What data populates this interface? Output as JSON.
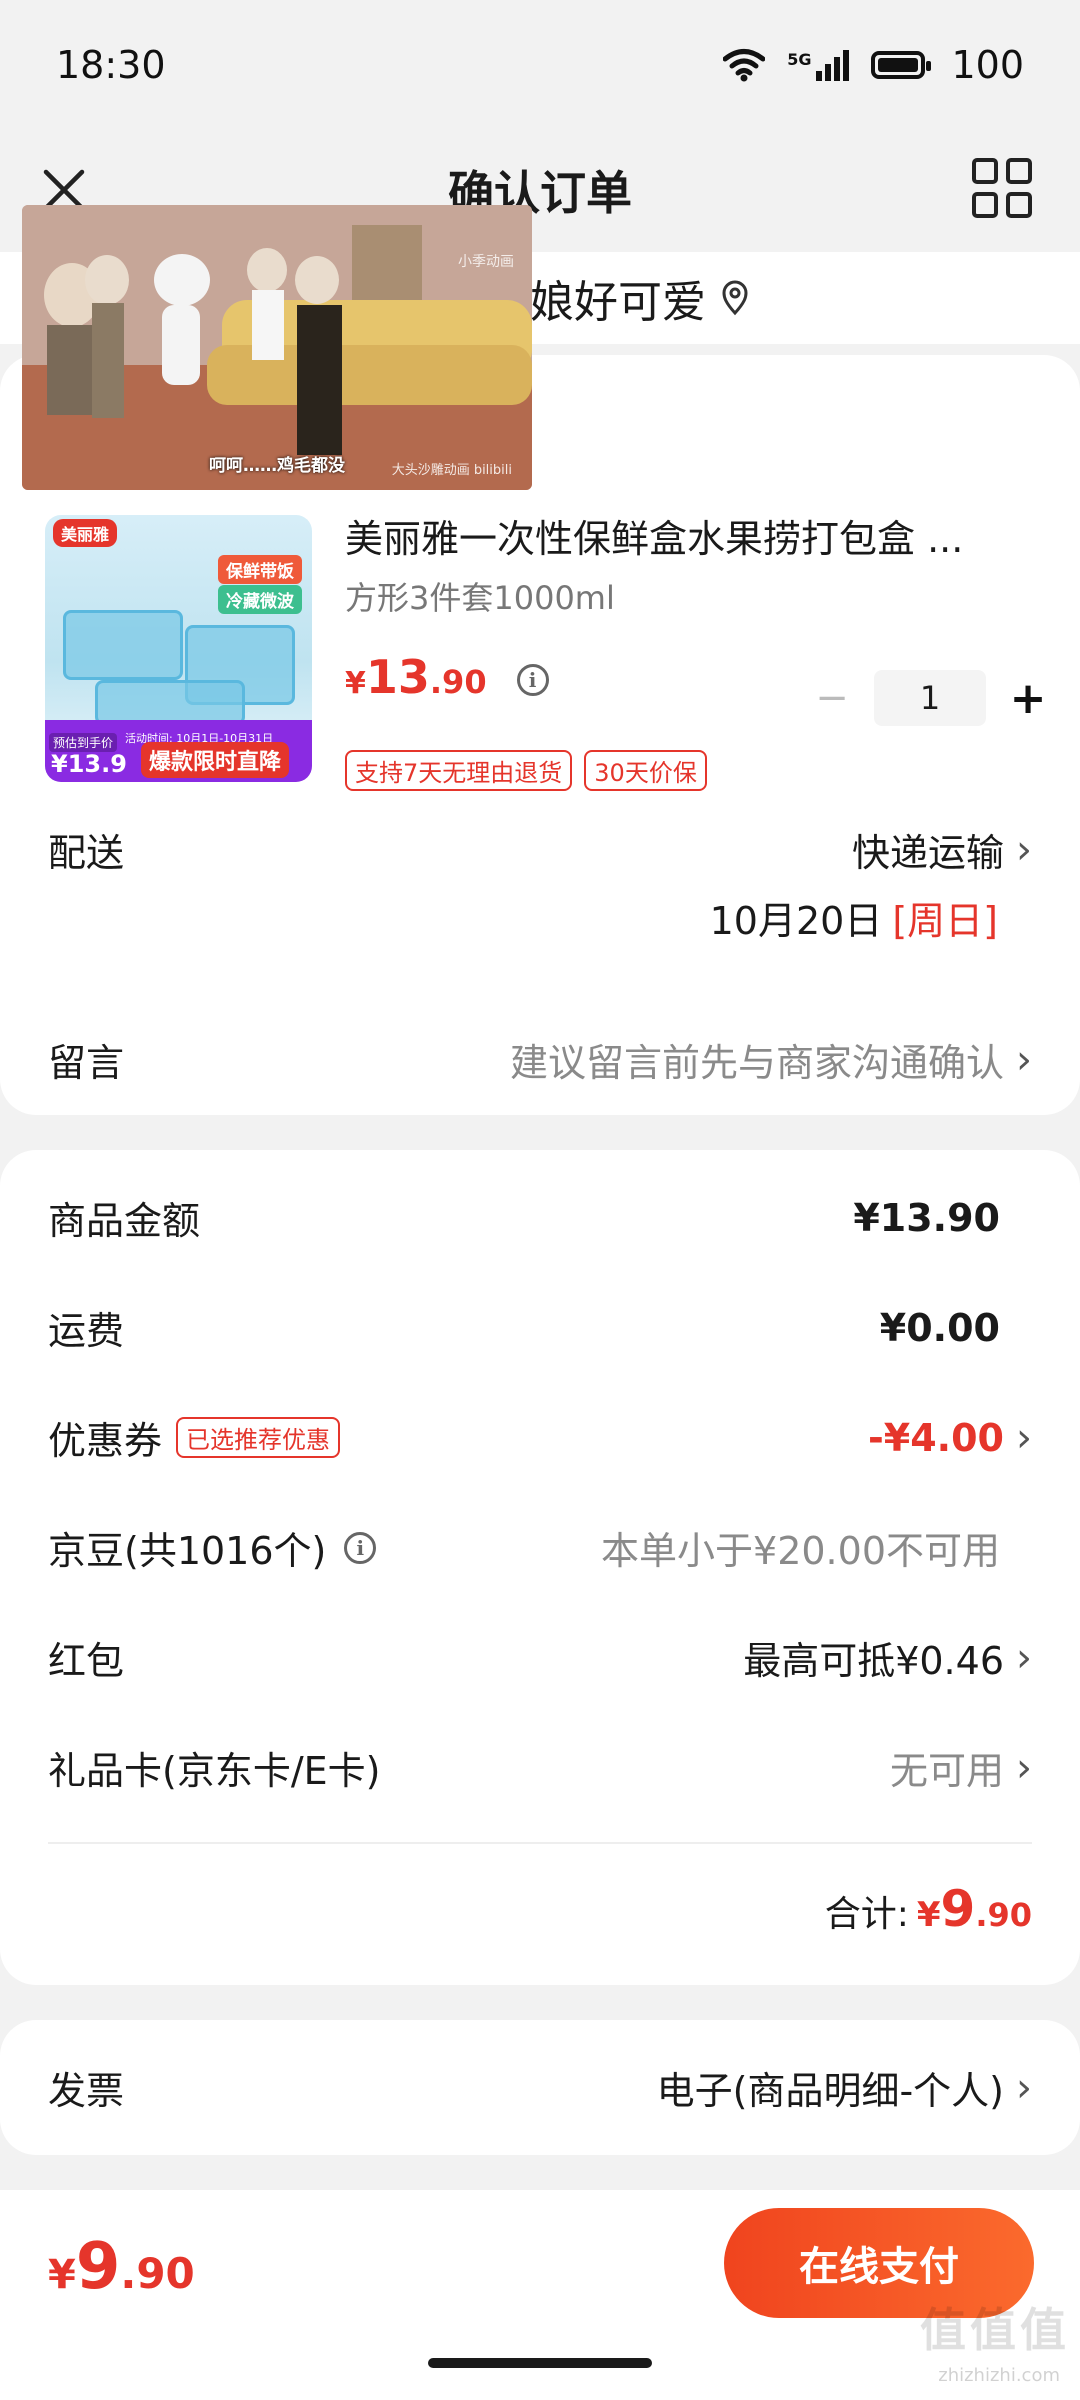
{
  "status_bar": {
    "time": "18:30",
    "battery": "100",
    "network": "5G"
  },
  "nav": {
    "title": "确认订单"
  },
  "address": {
    "text": "娘好可爱"
  },
  "video": {
    "caption": "呵呵……鸡毛都没",
    "watermark_top": "小季动画",
    "watermark_bottom": "大头沙雕动画 bilibili"
  },
  "product": {
    "image": {
      "brand": "美丽雅",
      "tag1": "保鲜带饭",
      "tag2": "冷藏微波",
      "pre_label": "预估到手价",
      "price": "¥13.9",
      "time": "活动时间: 10月1日-10月31日",
      "promo": "爆款限时直降"
    },
    "title": "美丽雅一次性保鲜盒水果捞打包盒 ...",
    "spec": "方形3件套1000ml",
    "price_currency": "¥",
    "price_int": "13",
    "price_dec": ".90",
    "quantity": "1",
    "badges": [
      "支持7天无理由退货",
      "30天价保"
    ]
  },
  "delivery": {
    "label": "配送",
    "method": "快递运输",
    "date": "10月20日",
    "weekday": "[周日]"
  },
  "message": {
    "label": "留言",
    "placeholder": "建议留言前先与商家沟通确认"
  },
  "summary": {
    "goods_label": "商品金额",
    "goods_value": "¥13.90",
    "shipping_label": "运费",
    "shipping_value": "¥0.00",
    "coupon_label": "优惠券",
    "coupon_tag": "已选推荐优惠",
    "coupon_value": "-¥4.00",
    "beans_label": "京豆(共1016个)",
    "beans_value": "本单小于¥20.00不可用",
    "redpacket_label": "红包",
    "redpacket_value": "最高可抵¥0.46",
    "giftcard_label": "礼品卡(京东卡/E卡)",
    "giftcard_value": "无可用",
    "total_label": "合计:",
    "total_currency": "¥",
    "total_int": "9",
    "total_dec": ".90"
  },
  "invoice": {
    "label": "发票",
    "value": "电子(商品明细-个人)"
  },
  "footer": {
    "currency": "¥",
    "int": "9",
    "dec": ".90",
    "pay_label": "在线支付"
  },
  "watermark": {
    "text": "值值值",
    "sub": "zhizhizhi.com"
  },
  "colors": {
    "accent": "#e5352b",
    "pay_gradient_start": "#f0441e",
    "pay_gradient_end": "#fb6a2d"
  }
}
